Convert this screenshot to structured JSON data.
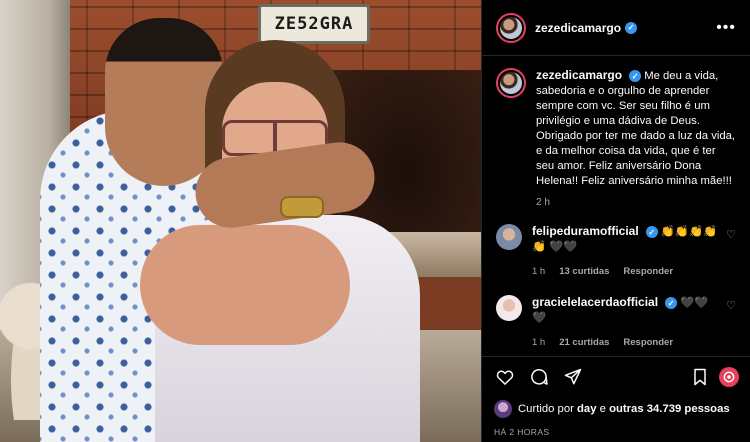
{
  "post": {
    "username": "zezedicamargo",
    "verified_glyph": "✓",
    "more_glyph": "•••",
    "plate_text": "ZE52GRA"
  },
  "caption": {
    "username": "zezedicamargo",
    "text": "Me deu a vida, sabedoria e o orgulho de aprender sempre com vc. Ser seu filho é um privilégio e uma dádiva de Deus. Obrigado por ter me dado a luz da vida, e da melhor coisa da vida, que é ter seu amor. Feliz aniversário Dona Helena!! Feliz aniversário minha mãe!!!",
    "time": "2 h"
  },
  "comments": [
    {
      "username": "felipeduramofficial",
      "text": "👏👏👏👏👏 🖤🖤",
      "time": "1 h",
      "likes": "13 curtidas",
      "reply": "Responder"
    },
    {
      "username": "gracielelacerdaofficial",
      "text": "🖤🖤🖤",
      "time": "1 h",
      "likes": "21 curtidas",
      "reply": "Responder"
    }
  ],
  "likes": {
    "prefix": "Curtido por",
    "user": "day",
    "connector": "e",
    "others": "outras 34.739 pessoas"
  },
  "posted_ago": "HÁ 2 HORAS",
  "colors": {
    "accent": "#3897f0",
    "story_ring": "#e4405f",
    "background": "#000000",
    "secondary_text": "#a8a8a8"
  },
  "icons": [
    "more-options-icon",
    "verified-icon",
    "heart-icon",
    "comment-icon",
    "share-icon",
    "bookmark-icon",
    "promote-icon"
  ]
}
